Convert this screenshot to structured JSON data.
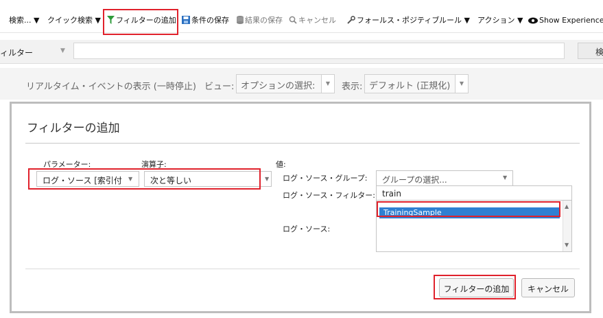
{
  "toolbar": {
    "search": "検索... ▼",
    "quick_search": "クイック検索 ▼",
    "add_filter": "フィルターの追加",
    "save_criteria": "条件の保存",
    "save_results": "結果の保存",
    "cancel": "キャンセル",
    "false_positive": "フォールス・ポジティブ",
    "rules": "ルール ▼",
    "actions": "アクション ▼",
    "show_experience": "Show Experience"
  },
  "filterbar": {
    "label": "ィルター",
    "search_button": "検"
  },
  "realtime": {
    "display_text": "リアルタイム・イベントの表示 (一時停止)",
    "view_label": "ビュー:",
    "view_value": "オプションの選択:",
    "display_label": "表示:",
    "display_value": "デフォルト (正規化)"
  },
  "dialog": {
    "title": "フィルターの追加",
    "parameter_label": "パラメーター:",
    "operator_label": "演算子:",
    "value_label": "値:",
    "parameter_value": "ログ・ソース [索引付",
    "operator_value": "次と等しい",
    "group_label": "ログ・ソース・グループ:",
    "group_value": "グループの選択...",
    "source_filter_label": "ログ・ソース・フィルター:",
    "source_filter_value": "train",
    "source_label": "ログ・ソース:",
    "source_items": [
      "TrainingSample"
    ],
    "add_button": "フィルターの追加",
    "cancel_button": "キャンセル"
  },
  "colors": {
    "highlight": "#e0212b",
    "selection": "#2f80d2",
    "filter_icon": "#2e9b3a",
    "save_icon": "#2a6fc0"
  }
}
